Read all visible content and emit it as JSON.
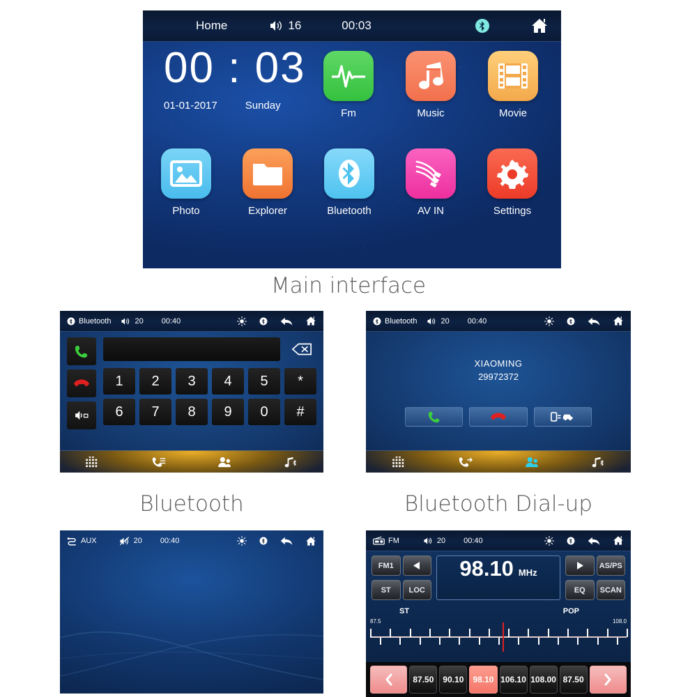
{
  "main": {
    "statusbar": {
      "title": "Home",
      "volume": "16",
      "clock": "00:03",
      "bt_icon": "bluetooth-icon",
      "home_icon": "home-icon",
      "volume_icon": "volume-icon"
    },
    "clock": {
      "time": "00 : 03",
      "date": "01-01-2017",
      "weekday": "Sunday"
    },
    "apps_row1": [
      {
        "label": "Fm",
        "icon": "fm-waveform-icon",
        "color": "#35c13f"
      },
      {
        "label": "Music",
        "icon": "music-note-icon",
        "color": "#f2704c"
      },
      {
        "label": "Movie",
        "icon": "film-strip-icon",
        "color": "#f3a94b"
      }
    ],
    "apps_row2": [
      {
        "label": "Photo",
        "icon": "photo-icon",
        "color": "#49bced"
      },
      {
        "label": "Explorer",
        "icon": "folder-icon",
        "color": "#f07331"
      },
      {
        "label": "Bluetooth",
        "icon": "bluetooth-icon",
        "color": "#4ec3f0"
      },
      {
        "label": "AV IN",
        "icon": "rca-cables-icon",
        "color": "#ed2f9e"
      },
      {
        "label": "Settings",
        "icon": "gear-icon",
        "color": "#ec3b28"
      }
    ]
  },
  "captions": {
    "main": "Main interface",
    "bluetooth": "Bluetooth",
    "dialup": "Bluetooth Dial-up"
  },
  "bluetooth": {
    "statusbar": {
      "title": "Bluetooth",
      "volume": "20",
      "clock": "00:40",
      "source_icon": "bluetooth-icon",
      "brightness_icon": "brightness-icon",
      "bt_icon": "bluetooth-icon",
      "back_icon": "back-arrow-icon",
      "home_icon": "home-icon"
    },
    "dial_input_value": "",
    "keys": [
      "1",
      "2",
      "3",
      "4",
      "5",
      "*",
      "6",
      "7",
      "8",
      "9",
      "0",
      "#"
    ],
    "side_buttons": [
      "call-answer-icon",
      "call-end-icon",
      "speaker-toggle-icon"
    ],
    "delete_icon": "backspace-icon",
    "navbar": [
      "keypad-icon",
      "call-log-icon",
      "contacts-icon",
      "bt-music-icon"
    ]
  },
  "dialup": {
    "statusbar": {
      "title": "Bluetooth",
      "volume": "20",
      "clock": "00:40"
    },
    "caller_name": "XIAOMING",
    "caller_number": "29972372",
    "actions": [
      "call-answer-icon",
      "call-end-icon",
      "transfer-to-car-icon"
    ],
    "navbar": [
      "keypad-icon",
      "call-log-icon",
      "contacts-icon",
      "bt-music-icon"
    ],
    "navbar_active_index": 2,
    "active_color": "#2ad2f0"
  },
  "aux": {
    "statusbar": {
      "title": "AUX",
      "volume": "20",
      "clock": "00:40",
      "source_icon": "aux-icon",
      "volume_icon": "volume-muted-icon",
      "brightness_icon": "brightness-icon",
      "bt_icon": "bluetooth-icon",
      "back_icon": "back-arrow-icon",
      "home_icon": "home-icon"
    }
  },
  "fm": {
    "statusbar": {
      "title": "FM",
      "volume": "20",
      "clock": "00:40",
      "source_icon": "radio-icon",
      "brightness_icon": "brightness-icon",
      "bt_icon": "bluetooth-icon",
      "back_icon": "back-arrow-icon",
      "home_icon": "home-icon"
    },
    "band": "FM1",
    "prev_icon": "prev-arrow-icon",
    "next_icon": "next-arrow-icon",
    "btn_st": "ST",
    "btn_loc": "LOC",
    "btn_asps": "AS/PS",
    "btn_eq": "EQ",
    "btn_scan": "SCAN",
    "frequency": "98.10",
    "unit": "MHz",
    "stereo_label": "ST",
    "genre_label": "POP",
    "scale_min": "87.5",
    "scale_max": "108.0",
    "presets": [
      "87.50",
      "90.10",
      "98.10",
      "106.10",
      "108.00",
      "87.50"
    ],
    "active_preset_index": 2,
    "nav_prev_icon": "preset-prev-icon",
    "nav_next_icon": "preset-next-icon",
    "highlight_color": "#f4776a"
  }
}
